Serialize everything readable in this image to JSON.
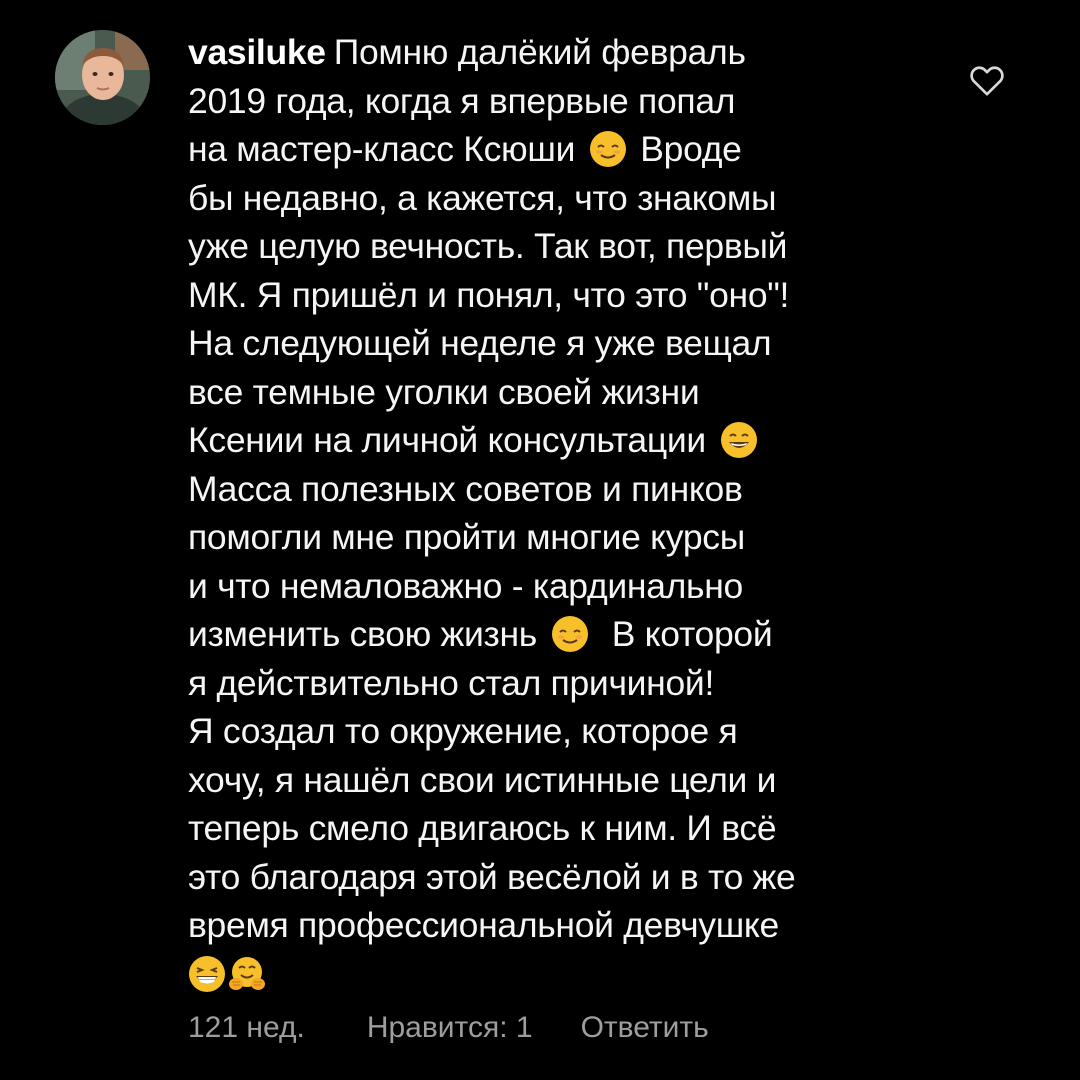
{
  "comment": {
    "username": "vasiluke",
    "lines": [
      "Помню далёкий февраль",
      "2019 года, когда я впервые попал",
      "на мастер-класс Ксюши",
      "Вроде",
      "бы недавно, а кажется, что знакомы",
      "уже целую вечность. Так вот, первый",
      "МК. Я пришёл и понял, что это \"оно\"!",
      "На следующей неделе я уже вещал",
      "все темные уголки своей жизни",
      "Ксении на личной консультации",
      "Масса полезных советов и пинков",
      "помогли мне пройти многие курсы",
      "и что немаловажно - кардинально",
      "изменить свою жизнь",
      "В которой",
      "я действительно стал причиной!",
      "Я создал то окружение, которое я",
      "хочу, я нашёл свои истинные цели и",
      "теперь смело двигаюсь к ним. И всё",
      "это благодаря этой весёлой и в то же",
      "время профессиональной девчушке"
    ],
    "emojis": {
      "relieved": "relieved-face-emoji",
      "smile": "grinning-face-emoji",
      "beaming": "beaming-face-emoji",
      "hug": "hugging-face-emoji"
    }
  },
  "footer": {
    "time": "121 нед.",
    "likes": "Нравится: 1",
    "reply": "Ответить"
  },
  "icons": {
    "like": "heart-outline-icon",
    "avatar": "user-avatar"
  },
  "colors": {
    "background": "#000000",
    "text": "#f5f5f5",
    "secondary": "#9e9e9e",
    "emoji_yellow": "#f7c02b"
  }
}
